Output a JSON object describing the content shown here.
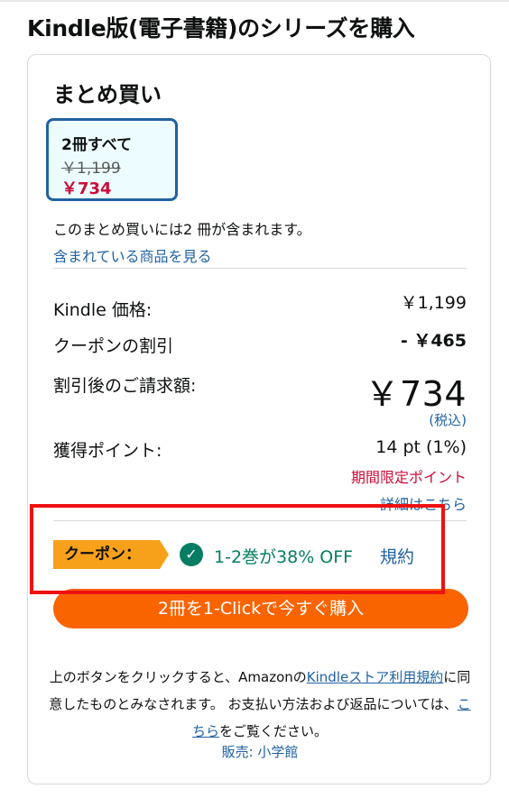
{
  "page": {
    "title": "Kindle版(電子書籍)のシリーズを購入"
  },
  "bundle": {
    "heading": "まとめ買い",
    "tile": {
      "label": "2冊すべて",
      "list_price": "￥1,199",
      "price": "￥734"
    },
    "includes_text": "このまとめ買いには2 冊が含まれます。",
    "see_items_link": "含まれている商品を見る"
  },
  "pricing": {
    "kindle_price_label": "Kindle 価格:",
    "kindle_price_value": "￥1,199",
    "coupon_discount_label": "クーポンの割引",
    "coupon_discount_value": "- ￥465",
    "final_label": "割引後のご請求額:",
    "final_value": "￥734",
    "tax_note": "(税込)",
    "points_label": "獲得ポイント:",
    "points_value": "14 pt (1%)",
    "limited_points": "期間限定ポイント",
    "details_link": "詳細はこちら"
  },
  "coupon": {
    "badge": "クーポン：",
    "text": "1-2巻が38% OFF",
    "terms_link": "規約"
  },
  "buy_button": {
    "label": "2冊を1-Clickで今すぐ購入"
  },
  "fineprint": {
    "part1": "上のボタンをクリックすると、Amazonの",
    "store_terms_link": "Kindleストア利用規約",
    "part2": "に同意したものとみなされます。 お支払い方法および返品については、",
    "here_link": "こちら",
    "part3": "をご覧ください。"
  },
  "seller": {
    "text": "販売: 小学館"
  },
  "colors": {
    "accent_blue": "#2162a1",
    "price_red": "#cc0c39",
    "coupon_green": "#067d62",
    "coupon_badge": "#f7a11a",
    "buy_button": "#fa6400",
    "highlight_red": "#ee1111"
  },
  "icons": {
    "coupon_check": "check-circle-icon"
  }
}
